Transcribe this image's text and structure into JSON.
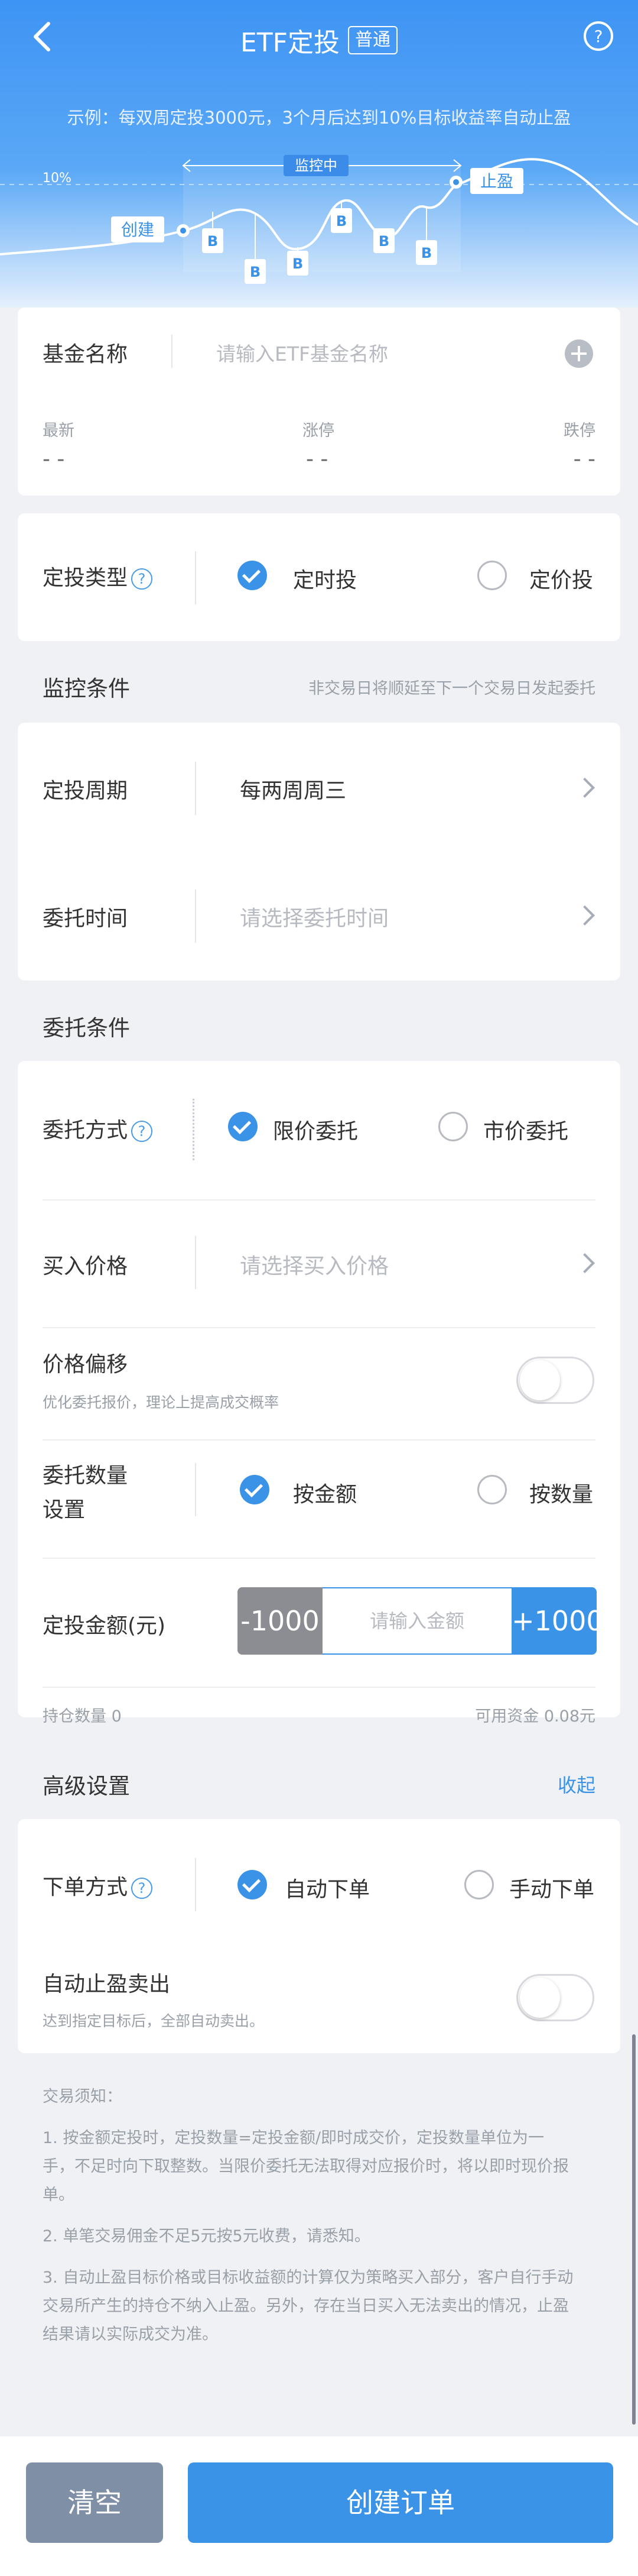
{
  "header": {
    "title": "ETF定投",
    "tag": "普通",
    "example": "示例：每双周定投3000元，3个月后达到10%目标收益率自动止盈"
  },
  "diagram": {
    "pct_label": "10%",
    "monitoring_label": "监控中",
    "create_label": "创建",
    "takeprofit_label": "止盈",
    "buy_marker": "B"
  },
  "fund": {
    "name_label": "基金名称",
    "name_placeholder": "请输入ETF基金名称",
    "latest_label": "最新",
    "latest_value": "- -",
    "limit_up_label": "涨停",
    "limit_up_value": "- -",
    "limit_down_label": "跌停",
    "limit_down_value": "- -"
  },
  "plan_type": {
    "label": "定投类型",
    "option_time": "定时投",
    "option_price": "定价投",
    "selected": "定时投"
  },
  "monitor": {
    "title": "监控条件",
    "note": "非交易日将顺延至下一个交易日发起委托",
    "cycle_label": "定投周期",
    "cycle_value": "每两周周三",
    "time_label": "委托时间",
    "time_placeholder": "请选择委托时间"
  },
  "order": {
    "title": "委托条件",
    "method_label": "委托方式",
    "method_limit": "限价委托",
    "method_market": "市价委托",
    "buy_price_label": "买入价格",
    "buy_price_placeholder": "请选择买入价格",
    "offset_label": "价格偏移",
    "offset_note": "优化委托报价，理论上提高成交概率",
    "qty_label_line1": "委托数量",
    "qty_label_line2": "设置",
    "qty_by_amount": "按金额",
    "qty_by_count": "按数量",
    "amount_label": "定投金额(元)",
    "minus_button": "-1000",
    "amount_placeholder": "请输入金额",
    "plus_button": "+1000",
    "holding": "持仓数量 0",
    "available": "可用资金 0.08元"
  },
  "advanced": {
    "title": "高级设置",
    "collapse": "收起",
    "order_mode_label": "下单方式",
    "order_auto": "自动下单",
    "order_manual": "手动下单",
    "auto_tp_label": "自动止盈卖出",
    "auto_tp_note": "达到指定目标后，全部自动卖出。"
  },
  "notice": {
    "title": "交易须知：",
    "item1_line1": "1. 按金额定投时，定投数量=定投金额/即时成交价，定投数量单位为一",
    "item1_line2": "手，不足时向下取整数。当限价委托无法取得对应报价时，将以即时现价报",
    "item1_line3": "单。",
    "item2": "2. 单笔交易佣金不足5元按5元收费，请悉知。",
    "item3_line1": "3. 自动止盈目标价格或目标收益额的计算仅为策略买入部分，客户自行手动",
    "item3_line2": "交易所产生的持仓不纳入止盈。另外，存在当日买入无法卖出的情况，止盈",
    "item3_line3": "结果请以实际成交为准。"
  },
  "footer": {
    "clear_button": "清空",
    "create_button": "创建订单"
  },
  "colors": {
    "primary": "#3a93e6",
    "clear": "#7f8fa6"
  }
}
